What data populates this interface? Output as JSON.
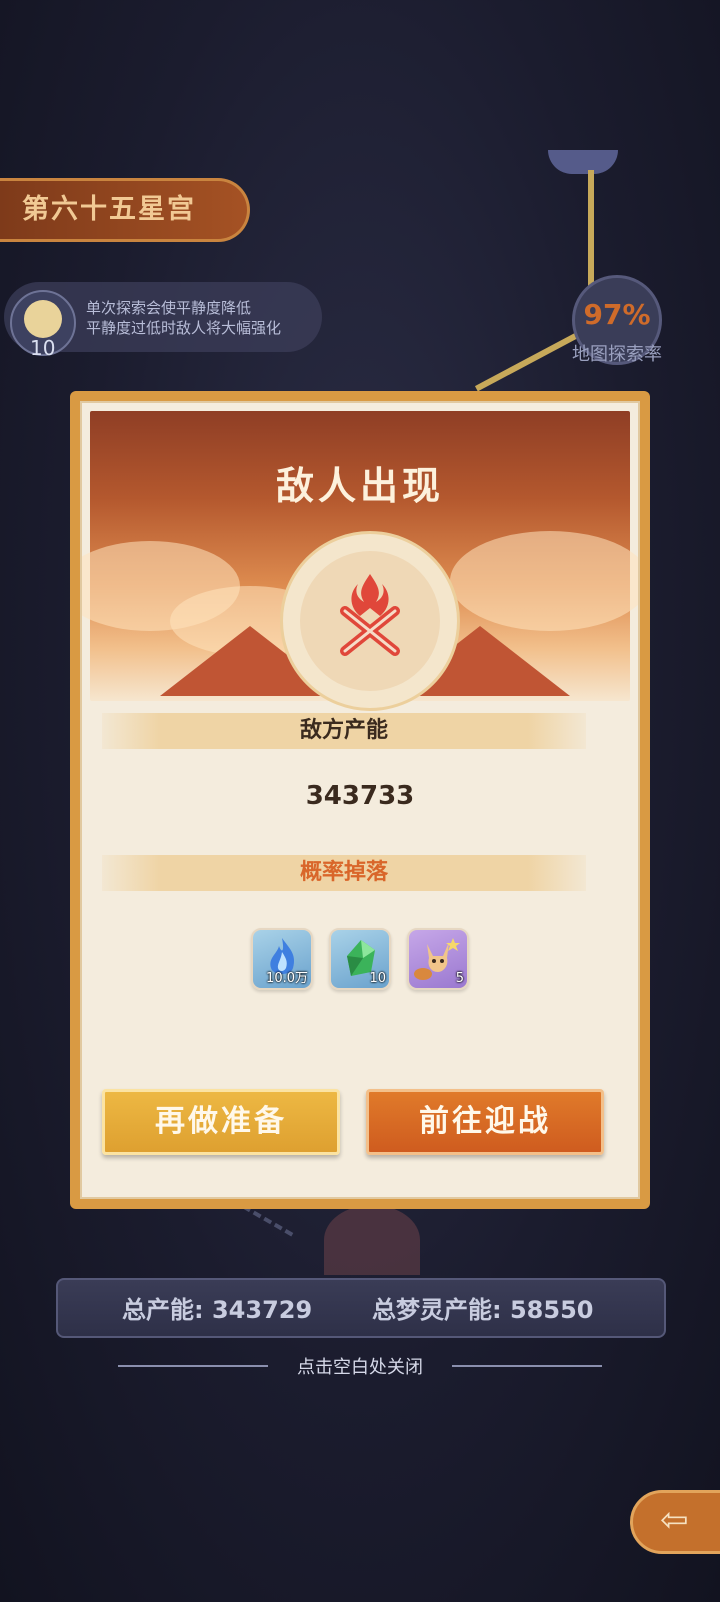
{
  "background": {
    "stage_name": "第六十五星宫",
    "calm": {
      "value": "10",
      "line1": "单次探索会使平静度降低",
      "line2": "平静度过低时敌人将大幅强化"
    },
    "explore": {
      "rate": "97%",
      "label": "地图探索率"
    },
    "stats": {
      "total_power_label": "总产能:",
      "total_power_value": "343729",
      "dream_power_label": "总梦灵产能:",
      "dream_power_value": "58550"
    },
    "close_hint": "点击空白处关闭"
  },
  "modal": {
    "title": "敌人出现",
    "enemy_power_label": "敌方产能",
    "enemy_power_value": "343733",
    "drop_label": "概率掉落",
    "drops": [
      {
        "icon": "blue-flame-icon",
        "count": "10.0万"
      },
      {
        "icon": "green-gem-icon",
        "count": "10"
      },
      {
        "icon": "fox-spirit-icon",
        "count": "5"
      }
    ],
    "prepare_button": "再做准备",
    "fight_button": "前往迎战"
  },
  "colors": {
    "accent_orange": "#d9662a",
    "accent_gold": "#e8ad3c",
    "drop_label": "#d9662a"
  }
}
